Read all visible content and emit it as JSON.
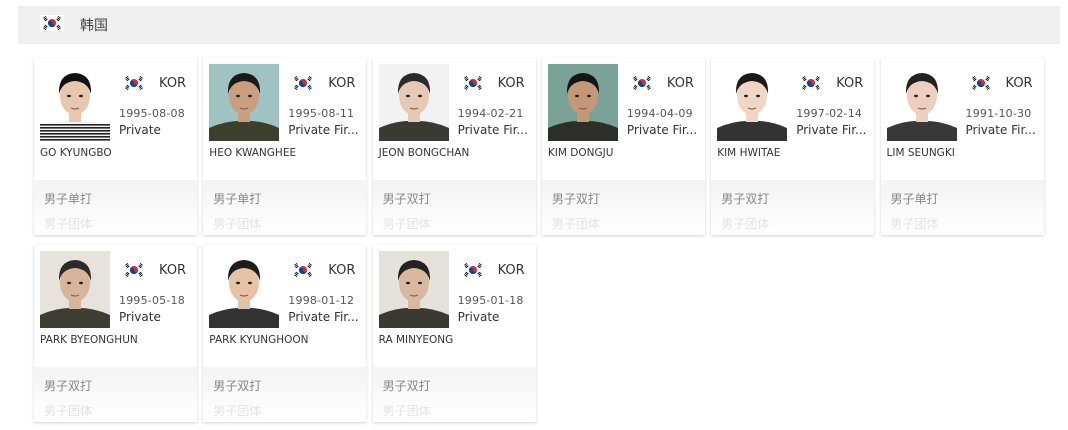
{
  "header": {
    "title": "韩国",
    "flag_icon": "south-korea-flag-icon"
  },
  "colors": {
    "flag_red": "#cd2e3a",
    "flag_blue": "#0047a0",
    "header_bg": "#efefef"
  },
  "players": [
    {
      "name": "GO KYUNGBO",
      "country": "KOR",
      "dob": "1995-08-08",
      "rank": "Private",
      "event1": "男子单打",
      "event2": "男子团体",
      "photo": {
        "bg": "#ffffff",
        "hair": "#111111",
        "skin": "#e8c7b0",
        "shirt": "stripes"
      }
    },
    {
      "name": "HEO KWANGHEE",
      "country": "KOR",
      "dob": "1995-08-11",
      "rank": "Private Fir...",
      "event1": "男子单打",
      "event2": "男子团体",
      "photo": {
        "bg": "#9fc3c3",
        "hair": "#1a1a1a",
        "skin": "#c99f80",
        "shirt": "#3b3f2c"
      }
    },
    {
      "name": "JEON BONGCHAN",
      "country": "KOR",
      "dob": "1994-02-21",
      "rank": "Private Fir...",
      "event1": "男子双打",
      "event2": "男子团体",
      "photo": {
        "bg": "#f2f2f2",
        "hair": "#2a2a2a",
        "skin": "#e6c9b5",
        "shirt": "#3a3a33"
      }
    },
    {
      "name": "KIM DONGJU",
      "country": "KOR",
      "dob": "1994-04-09",
      "rank": "Private Fir...",
      "event1": "男子双打",
      "event2": "男子团体",
      "photo": {
        "bg": "#7aa398",
        "hair": "#151515",
        "skin": "#c39878",
        "shirt": "#2c2f27"
      }
    },
    {
      "name": "KIM HWITAE",
      "country": "KOR",
      "dob": "1997-02-14",
      "rank": "Private Fir...",
      "event1": "男子双打",
      "event2": "男子团体",
      "photo": {
        "bg": "#ffffff",
        "hair": "#1a1a1a",
        "skin": "#f0d6c4",
        "shirt": "#333333"
      }
    },
    {
      "name": "LIM SEUNGKI",
      "country": "KOR",
      "dob": "1991-10-30",
      "rank": "Private Fir...",
      "event1": "男子单打",
      "event2": "男子团体",
      "photo": {
        "bg": "#ffffff",
        "hair": "#222222",
        "skin": "#eccfbc",
        "shirt": "#383838"
      }
    },
    {
      "name": "PARK BYEONGHUN",
      "country": "KOR",
      "dob": "1995-05-18",
      "rank": "Private",
      "event1": "男子双打",
      "event2": "男子团体",
      "photo": {
        "bg": "#e7e3dc",
        "hair": "#2a2a2a",
        "skin": "#d8b59a",
        "shirt": "#3d3d33"
      }
    },
    {
      "name": "PARK KYUNGHOON",
      "country": "KOR",
      "dob": "1998-01-12",
      "rank": "Private Fir...",
      "event1": "男子双打",
      "event2": "男子团体",
      "photo": {
        "bg": "#ffffff",
        "hair": "#1d1d1d",
        "skin": "#e6c2a8",
        "shirt": "#333333"
      }
    },
    {
      "name": "RA MINYEONG",
      "country": "KOR",
      "dob": "1995-01-18",
      "rank": "Private",
      "event1": "男子双打",
      "event2": "男子团体",
      "photo": {
        "bg": "#e4e2da",
        "hair": "#232323",
        "skin": "#d9b8a0",
        "shirt": "#3a3a32"
      }
    }
  ]
}
